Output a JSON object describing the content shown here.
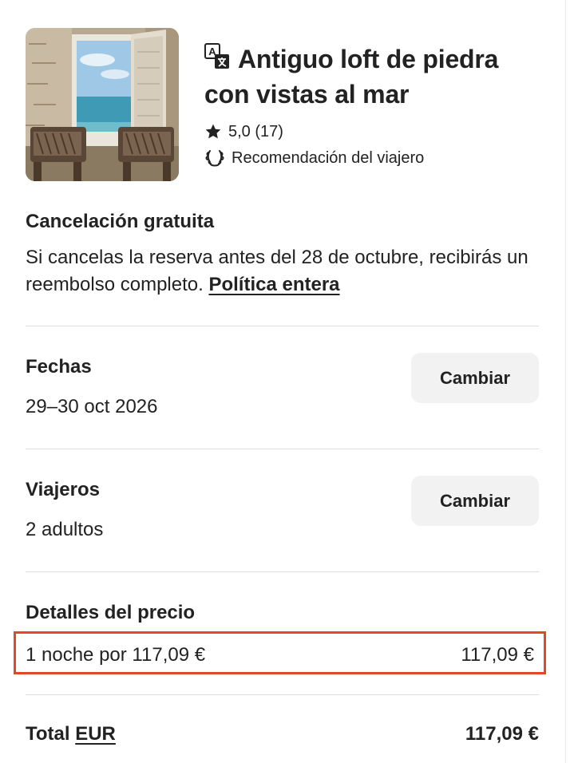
{
  "listing": {
    "title": "Antiguo loft de piedra con vistas al mar",
    "rating": "5,0 (17)",
    "badge": "Recomendación del viajero",
    "translate_icon": "translate-icon",
    "star_icon": "star-icon",
    "laurel_icon": "laurel-icon"
  },
  "cancellation": {
    "title": "Cancelación gratuita",
    "text": "Si cancelas la reserva antes del 28 de octubre, recibirás un reembolso completo.",
    "policy_link": "Política entera"
  },
  "dates": {
    "title": "Fechas",
    "value": "29–30 oct 2026",
    "change_label": "Cambiar"
  },
  "guests": {
    "title": "Viajeros",
    "value": "2 adultos",
    "change_label": "Cambiar"
  },
  "price": {
    "title": "Detalles del precio",
    "line_label": "1 noche por 117,09 €",
    "line_amount": "117,09 €",
    "highlight_color": "#e04826"
  },
  "total": {
    "label": "Total",
    "currency": "EUR",
    "amount": "117,09 €"
  },
  "colors": {
    "text": "#222222",
    "divider": "#dddddd",
    "button_bg": "#f2f2f2"
  }
}
